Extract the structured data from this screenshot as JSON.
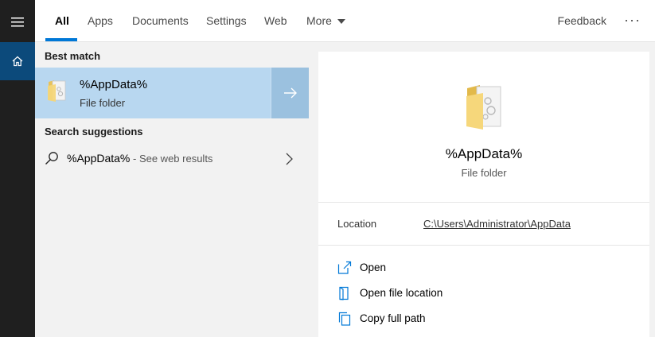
{
  "rail": {
    "menu_icon": "hamburger-icon",
    "home_icon": "home-icon"
  },
  "tabs": [
    {
      "label": "All",
      "active": true
    },
    {
      "label": "Apps"
    },
    {
      "label": "Documents"
    },
    {
      "label": "Settings"
    },
    {
      "label": "Web"
    },
    {
      "label": "More"
    }
  ],
  "topbar": {
    "feedback": "Feedback",
    "ellipsis": "···"
  },
  "results": {
    "best_match_header": "Best match",
    "best_match": {
      "title": "%AppData%",
      "subtitle": "File folder"
    },
    "suggestions_header": "Search suggestions",
    "suggestion": {
      "query": "%AppData%",
      "hint": " - See web results"
    }
  },
  "preview": {
    "title": "%AppData%",
    "subtitle": "File folder",
    "location_label": "Location",
    "location_value": "C:\\Users\\Administrator\\AppData",
    "actions": [
      {
        "label": "Open",
        "icon": "open-icon"
      },
      {
        "label": "Open file location",
        "icon": "file-location-icon"
      },
      {
        "label": "Copy full path",
        "icon": "copy-path-icon"
      }
    ]
  },
  "colors": {
    "accent": "#0078d7",
    "selected_bg": "#b8d7f0",
    "rail_bg": "#1f1f1f",
    "home_bg": "#0c4a7b"
  }
}
